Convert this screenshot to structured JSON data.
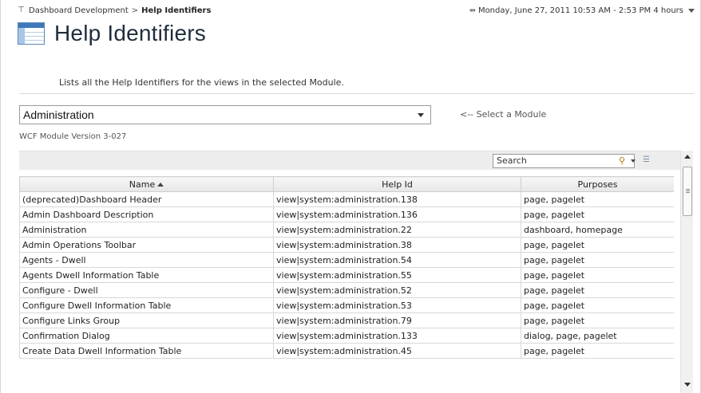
{
  "breadcrumb": {
    "icon": "dashboard-tree-icon",
    "parent": "Dashboard Development",
    "separator": ">",
    "current": "Help Identifiers"
  },
  "time_range": {
    "icon": "clock-arrow-icon",
    "label": "Monday, June 27, 2011 10:53 AM - 2:53 PM 4 hours"
  },
  "page": {
    "title": "Help Identifiers",
    "title_icon": "table-view-icon",
    "description": "Lists all the Help Identifiers for the views in the selected Module."
  },
  "module": {
    "selected": "Administration",
    "hint": "<-- Select a Module",
    "version": "WCF Module Version 3-027"
  },
  "search": {
    "placeholder": "Search"
  },
  "table": {
    "columns": [
      "Name",
      "Help Id",
      "Purposes"
    ],
    "sorted_column": "Name",
    "sort_direction": "ascending",
    "rows": [
      [
        "(deprecated)Dashboard Header",
        "view|system:administration.138",
        "page, pagelet"
      ],
      [
        "Admin Dashboard Description",
        "view|system:administration.136",
        "page, pagelet"
      ],
      [
        "Administration",
        "view|system:administration.22",
        "dashboard, homepage"
      ],
      [
        "Admin Operations Toolbar",
        "view|system:administration.38",
        "page, pagelet"
      ],
      [
        "Agents - Dwell",
        "view|system:administration.54",
        "page, pagelet"
      ],
      [
        "Agents Dwell Information Table",
        "view|system:administration.55",
        "page, pagelet"
      ],
      [
        "Configure - Dwell",
        "view|system:administration.52",
        "page, pagelet"
      ],
      [
        "Configure Dwell Information Table",
        "view|system:administration.53",
        "page, pagelet"
      ],
      [
        "Configure Links Group",
        "view|system:administration.79",
        "page, pagelet"
      ],
      [
        "Confirmation Dialog",
        "view|system:administration.133",
        "dialog, page, pagelet"
      ],
      [
        "Create Data Dwell Information Table",
        "view|system:administration.45",
        "page, pagelet"
      ]
    ]
  },
  "colors": {
    "title_text": "#1f2d3d",
    "icon_blue": "#3d78b8",
    "toolbar_bg": "#ededed"
  }
}
